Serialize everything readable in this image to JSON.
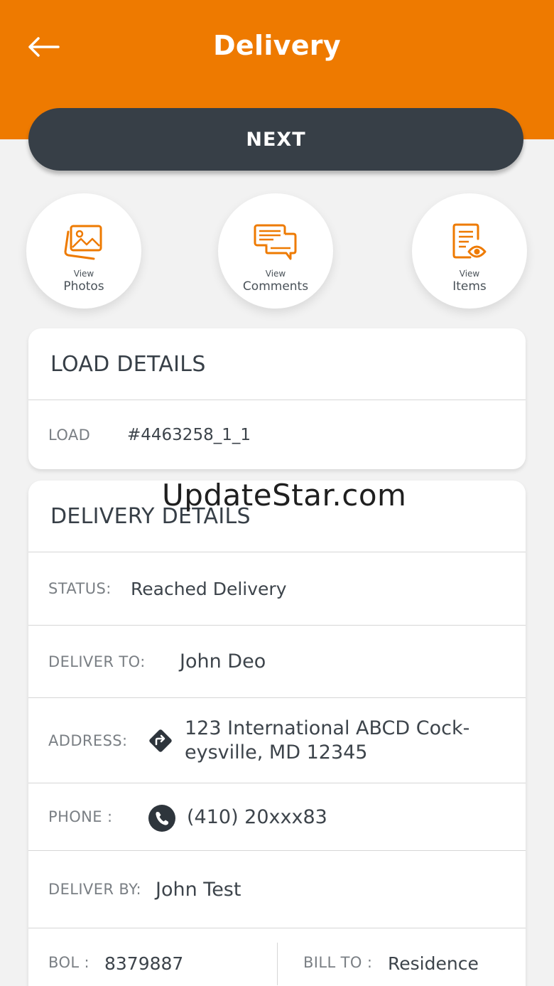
{
  "header": {
    "title": "Delivery",
    "back_icon": "arrow-left-icon",
    "color": "#ee7a00"
  },
  "next_button": {
    "label": "NEXT",
    "color": "#373f47"
  },
  "quick_actions": [
    {
      "small": "View",
      "label": "Photos",
      "icon": "photos-icon"
    },
    {
      "small": "View",
      "label": "Comments",
      "icon": "comments-icon"
    },
    {
      "small": "View",
      "label": "Items",
      "icon": "items-eye-icon"
    }
  ],
  "load_details": {
    "title": "LOAD DETAILS",
    "load_label": "LOAD",
    "load_value": "#4463258_1_1"
  },
  "watermark": "UpdateStar.com",
  "delivery_details": {
    "title": "DELIVERY DETAILS",
    "status_label": "STATUS:",
    "status_value": "Reached Delivery",
    "deliver_to_label": "DELIVER TO:",
    "deliver_to_value": "John Deo",
    "address_label": "ADDRESS:",
    "address_line1": "123 International ABCD Cock-",
    "address_line2": "eysville, MD 12345",
    "phone_label": "PHONE :",
    "phone_value": "(410) 20xxx83",
    "deliver_by_label": "DELIVER BY:",
    "deliver_by_value": "John Test",
    "bol_label": "BOL :",
    "bol_value": "8379887",
    "bill_to_label": "BILL TO :",
    "bill_to_value": "Residence"
  }
}
